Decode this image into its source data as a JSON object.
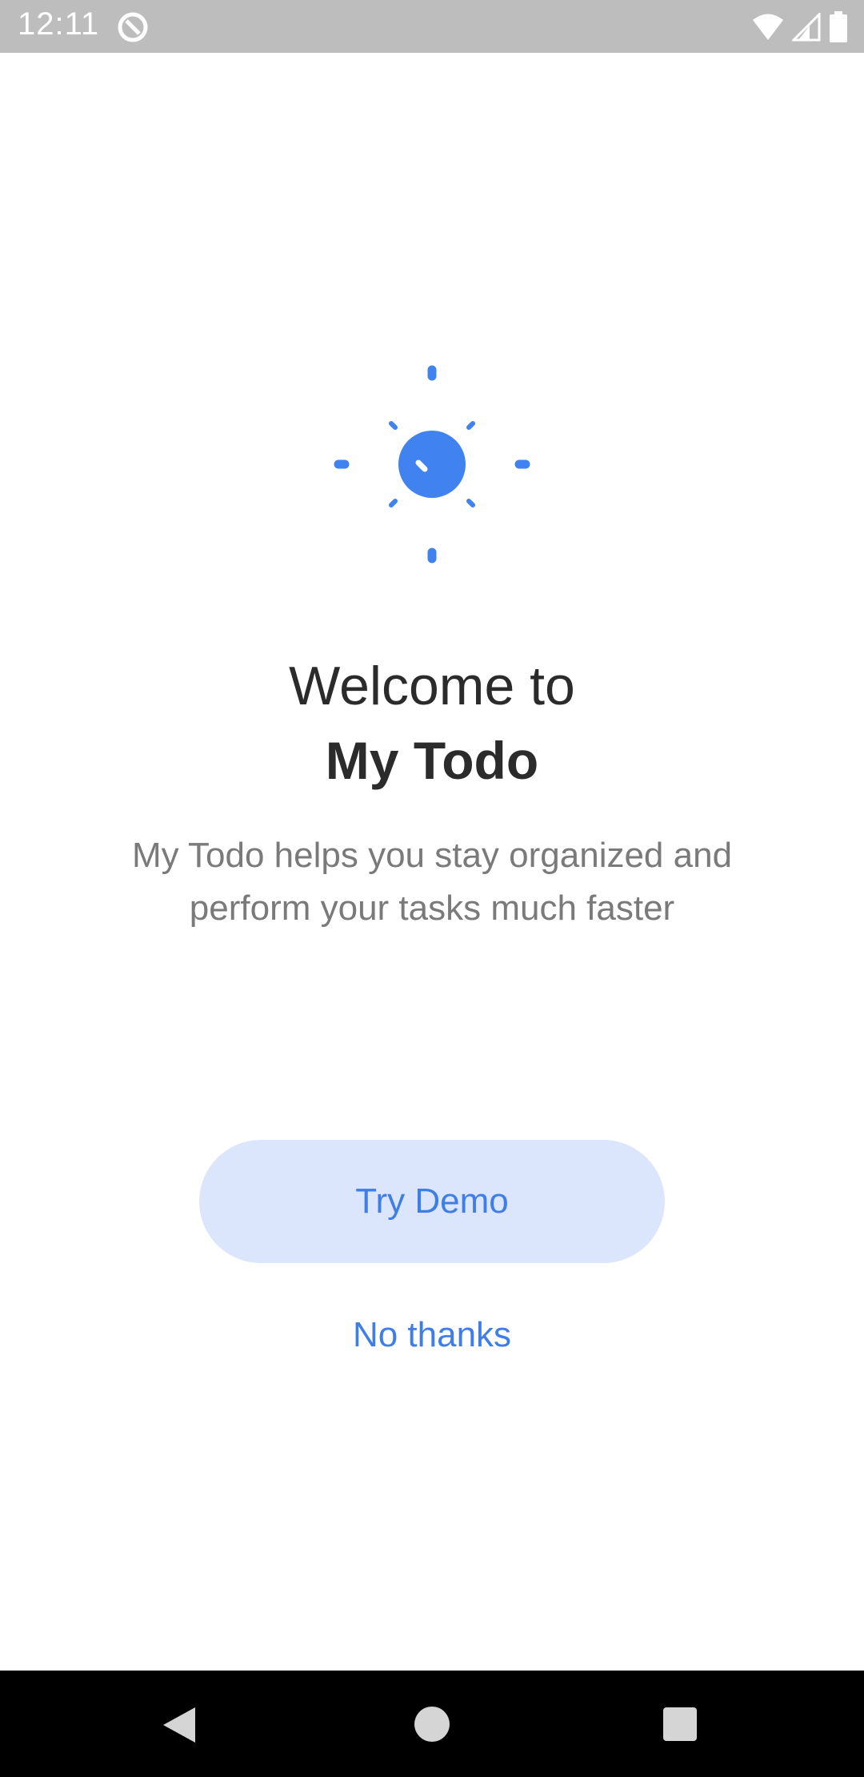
{
  "status_bar": {
    "time": "12:11",
    "icons": [
      "app-notification-icon",
      "wifi-icon",
      "signal-icon",
      "battery-icon"
    ]
  },
  "illustration": {
    "icon": "sun-icon",
    "color": "#3f82f0"
  },
  "welcome": {
    "line1": "Welcome to",
    "app_name": "My Todo",
    "description": "My Todo helps you stay organized and perform your tasks much faster"
  },
  "actions": {
    "try_demo_label": "Try Demo",
    "no_thanks_label": "No thanks",
    "accent_color": "#3f7de8",
    "button_bg": "#dbe6fc"
  },
  "nav_bar": {
    "buttons": [
      "back-icon",
      "home-icon",
      "recents-icon"
    ]
  }
}
